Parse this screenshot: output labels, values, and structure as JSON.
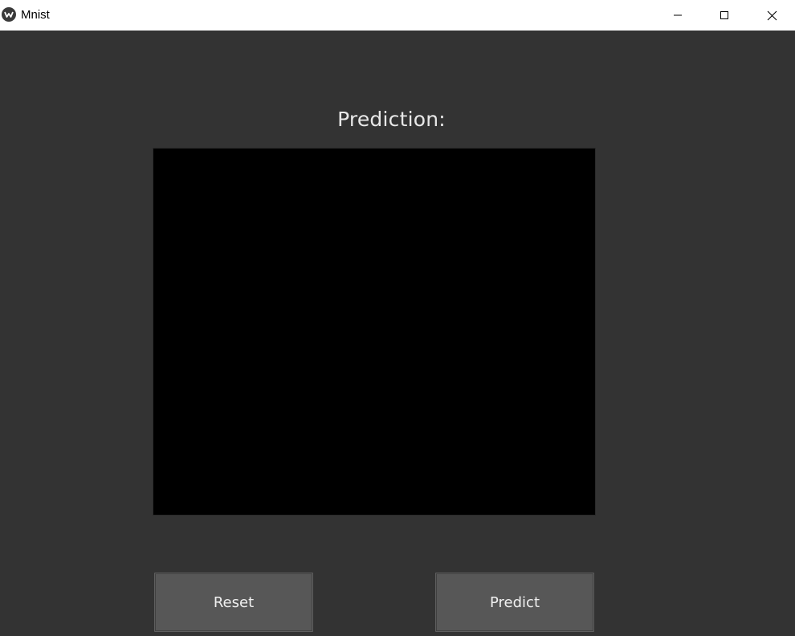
{
  "window": {
    "title": "Mnist",
    "app_icon": "kivy-logo-icon"
  },
  "controls": {
    "minimize_icon": "minimize-icon",
    "maximize_icon": "maximize-icon",
    "close_icon": "close-icon"
  },
  "main": {
    "prediction_label": "Prediction:",
    "canvas_color": "#000000",
    "background_color": "#333333"
  },
  "buttons": {
    "reset_label": "Reset",
    "predict_label": "Predict",
    "button_color": "#575757"
  }
}
